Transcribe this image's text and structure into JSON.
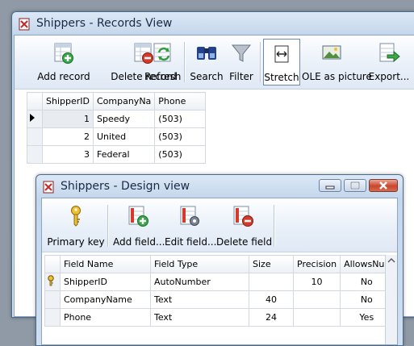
{
  "records_window": {
    "title": "Shippers - Records View",
    "toolbar": [
      {
        "label": "Add record",
        "icon": "add-record-icon"
      },
      {
        "label": "Delete record",
        "icon": "delete-record-icon"
      },
      {
        "label": "Refresh",
        "icon": "refresh-icon"
      },
      {
        "label": "Search",
        "icon": "search-icon"
      },
      {
        "label": "Filter",
        "icon": "filter-icon"
      },
      {
        "label": "Stretch",
        "icon": "stretch-icon"
      },
      {
        "label": "OLE as picture",
        "icon": "picture-icon"
      },
      {
        "label": "Export...",
        "icon": "export-icon"
      }
    ],
    "columns": [
      "ShipperID",
      "CompanyNa",
      "Phone"
    ],
    "rows": [
      {
        "id": "1",
        "company": "Speedy",
        "phone": "(503)"
      },
      {
        "id": "2",
        "company": "United",
        "phone": "(503)"
      },
      {
        "id": "3",
        "company": "Federal",
        "phone": "(503)"
      }
    ]
  },
  "design_window": {
    "title": "Shippers - Design view",
    "toolbar": [
      {
        "label": "Primary key",
        "icon": "key-icon"
      },
      {
        "label": "Add field...",
        "icon": "add-field-icon"
      },
      {
        "label": "Edit field...",
        "icon": "edit-field-icon"
      },
      {
        "label": "Delete field",
        "icon": "delete-field-icon"
      }
    ],
    "columns": [
      "Field Name",
      "Field Type",
      "Size",
      "Precision",
      "AllowsNull"
    ],
    "rows": [
      {
        "name": "ShipperID",
        "type": "AutoNumber",
        "size": "",
        "precision": "10",
        "allows_null": "No",
        "primary_key": true
      },
      {
        "name": "CompanyName",
        "type": "Text",
        "size": "40",
        "precision": "",
        "allows_null": "No",
        "primary_key": false
      },
      {
        "name": "Phone",
        "type": "Text",
        "size": "24",
        "precision": "",
        "allows_null": "Yes",
        "primary_key": false
      }
    ]
  },
  "colors": {
    "accent": "#3a6ea5",
    "delete": "#d63a2a",
    "add": "#3aa84a"
  }
}
